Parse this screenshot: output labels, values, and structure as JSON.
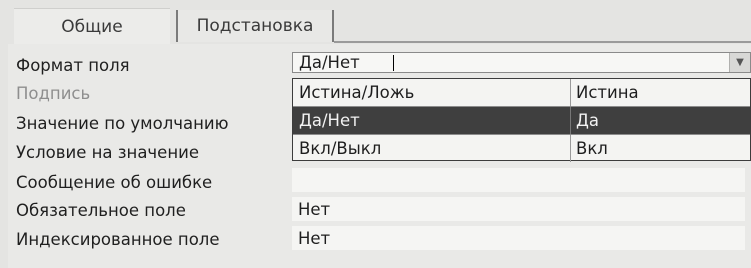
{
  "tabs": [
    {
      "label": "Общие",
      "active": true
    },
    {
      "label": "Подстановка",
      "active": false
    }
  ],
  "fields": [
    {
      "label": "Формат поля",
      "value": "Да/Нет"
    },
    {
      "label": "Подпись",
      "value": ""
    },
    {
      "label": "Значение по умолчанию",
      "value": ""
    },
    {
      "label": "Условие на значение",
      "value": ""
    },
    {
      "label": "Сообщение об ошибке",
      "value": ""
    },
    {
      "label": "Обязательное поле",
      "value": "Нет"
    },
    {
      "label": "Индексированное поле",
      "value": "Нет"
    }
  ],
  "format_dropdown": {
    "expanded": true,
    "options": [
      {
        "name": "Истина/Ложь",
        "example": "Истина",
        "selected": false
      },
      {
        "name": "Да/Нет",
        "example": "Да",
        "selected": true
      },
      {
        "name": "Вкл/Выкл",
        "example": "Вкл",
        "selected": false
      }
    ],
    "button_icon": "chevron-down-icon"
  },
  "colors": {
    "selection_bg": "#3f3f3f",
    "selection_fg": "#f2f2f2",
    "background": "#e4e4e2"
  }
}
